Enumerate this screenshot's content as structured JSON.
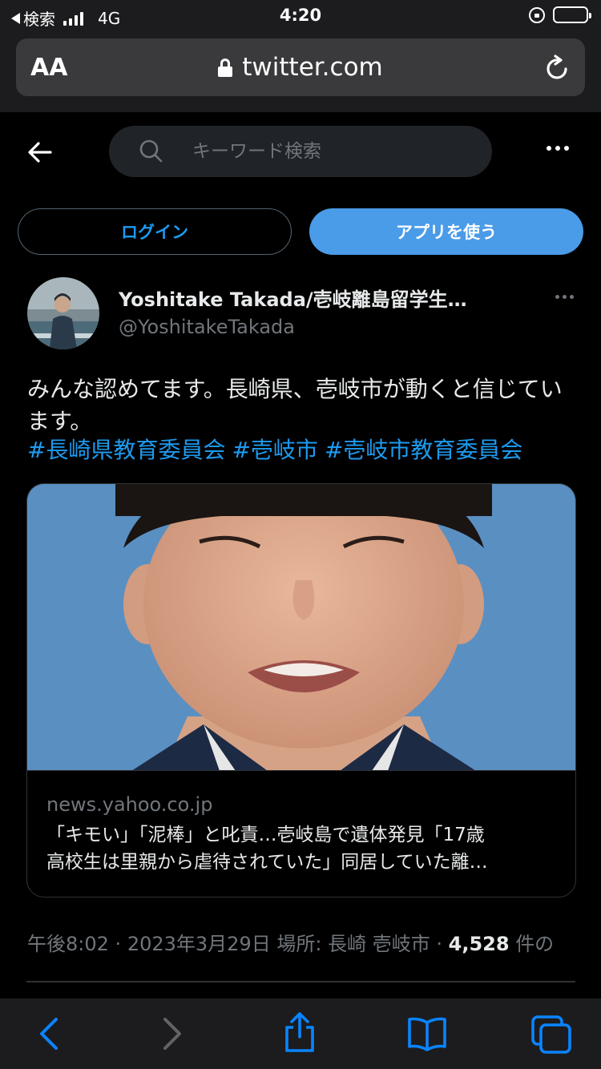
{
  "status_bar": {
    "back_label": "検索",
    "network": "4G",
    "time": "4:20"
  },
  "browser": {
    "text_size_label": "AA",
    "url": "twitter.com"
  },
  "search": {
    "placeholder": "キーワード検索"
  },
  "buttons": {
    "login": "ログイン",
    "use_app": "アプリを使う"
  },
  "author": {
    "name": "Yoshitake Takada/壱岐離島留学生…",
    "handle": "@YoshitakeTakada"
  },
  "tweet": {
    "text": "みんな認めてます。長崎県、壱岐市が動くと信じています。",
    "hashtags": [
      "#長崎県教育委員会",
      "#壱岐市",
      "#壱岐市教育委員会"
    ]
  },
  "card": {
    "domain": "news.yahoo.co.jp",
    "title_line1": "「キモい」「泥棒」と叱責…壱岐島で遺体発見「17歳",
    "title_line2": "高校生は里親から虐待されていた」同居していた離…"
  },
  "meta": {
    "time": "午後8:02",
    "separator": "·",
    "date": "2023年3月29日",
    "location": "場所: 長崎 壱岐市",
    "count": "4,528",
    "count_suffix": "件の"
  },
  "colors": {
    "accent": "#1d9bf0",
    "app_button": "#4a9be8",
    "safari_blue": "#0a84ff",
    "secondary_text": "#71767b"
  }
}
